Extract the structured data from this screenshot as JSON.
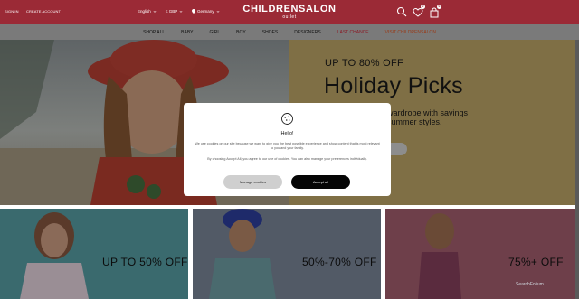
{
  "topbar": {
    "sign_in": "SIGN IN",
    "create_account": "CREATE ACCOUNT",
    "language": "English",
    "currency": "£ GBP",
    "country": "Germany",
    "logo_main": "CHILDRENSALON",
    "logo_sub": "outlet",
    "wishlist_count": "0",
    "cart_count": "0",
    "colors": {
      "bar": "#9b2a36"
    }
  },
  "nav": {
    "items": [
      "SHOP ALL",
      "BABY",
      "GIRL",
      "BOY",
      "SHOES",
      "DESIGNERS",
      "LAST CHANCE",
      "VISIT CHILDRENSALON"
    ]
  },
  "hero": {
    "kicker": "UP TO 80% OFF",
    "headline": "Holiday Picks",
    "sub_line1": "wardrobe with savings",
    "sub_line2": "summer styles."
  },
  "tiles": [
    {
      "label": "UP TO 50% OFF"
    },
    {
      "label": "50%-70% OFF"
    },
    {
      "label": "75%+ OFF"
    }
  ],
  "cookie_modal": {
    "title": "Hello!",
    "text1": "We use cookies on our site because we want to give you the best possible experience and show content that is most relevant to you and your family.",
    "text2": "By choosing Accept All, you agree to our use of cookies. You can also manage your preferences individually.",
    "manage_label": "Manage cookies",
    "accept_label": "Accept all"
  },
  "watermark": "SearchFolium"
}
